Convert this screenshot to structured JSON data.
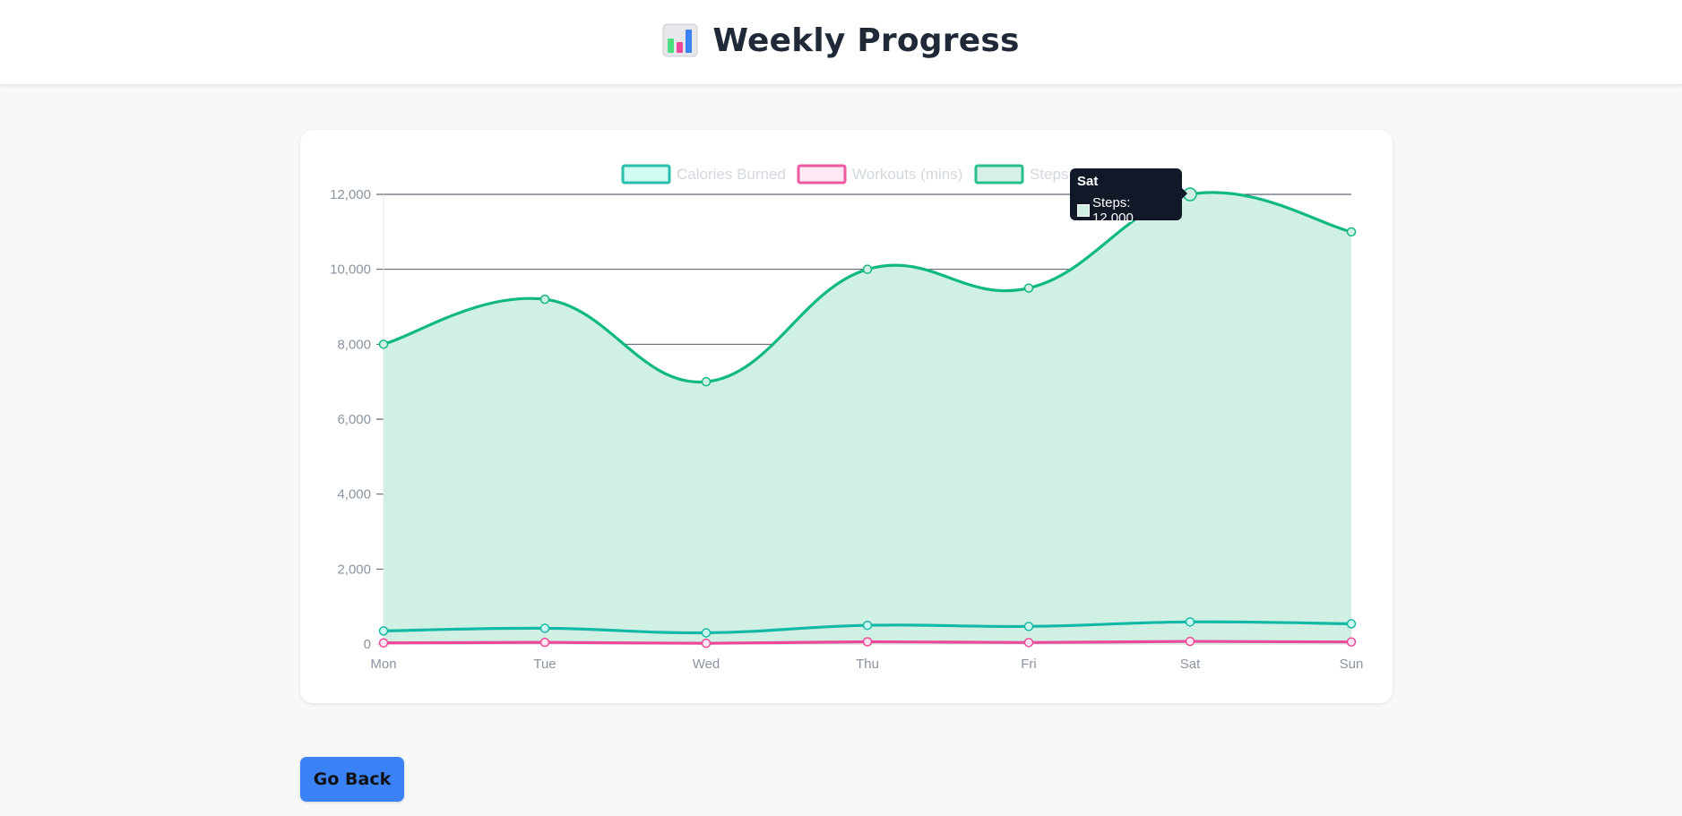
{
  "header": {
    "title": "Weekly Progress",
    "icon": "bar-chart-icon"
  },
  "buttons": {
    "go_back": "Go Back"
  },
  "tooltip": {
    "title": "Sat",
    "label": "Steps: 12,000",
    "swatch_color": "#d1f0e4"
  },
  "chart_data": {
    "type": "line",
    "categories": [
      "Mon",
      "Tue",
      "Wed",
      "Thu",
      "Fri",
      "Sat",
      "Sun"
    ],
    "series": [
      {
        "name": "Calories Burned",
        "values": [
          350,
          420,
          300,
          500,
          470,
          590,
          540
        ],
        "color": "#14b8a6",
        "fill": "#ccfbf1",
        "filled": false
      },
      {
        "name": "Workouts (mins)",
        "values": [
          30,
          45,
          20,
          60,
          40,
          70,
          55
        ],
        "color": "#ec4899",
        "fill": "#fce7f3",
        "filled": false
      },
      {
        "name": "Steps",
        "values": [
          8000,
          9200,
          7000,
          10000,
          9500,
          12000,
          11000
        ],
        "color": "#10b981",
        "fill": "#d1f0e4",
        "filled": true
      }
    ],
    "yticks": [
      "0",
      "2,000",
      "4,000",
      "6,000",
      "8,000",
      "10,000",
      "12,000"
    ],
    "ylim": [
      0,
      12000
    ],
    "grid": true,
    "legend": "top",
    "highlight": {
      "series": "Steps",
      "category": "Sat"
    }
  }
}
